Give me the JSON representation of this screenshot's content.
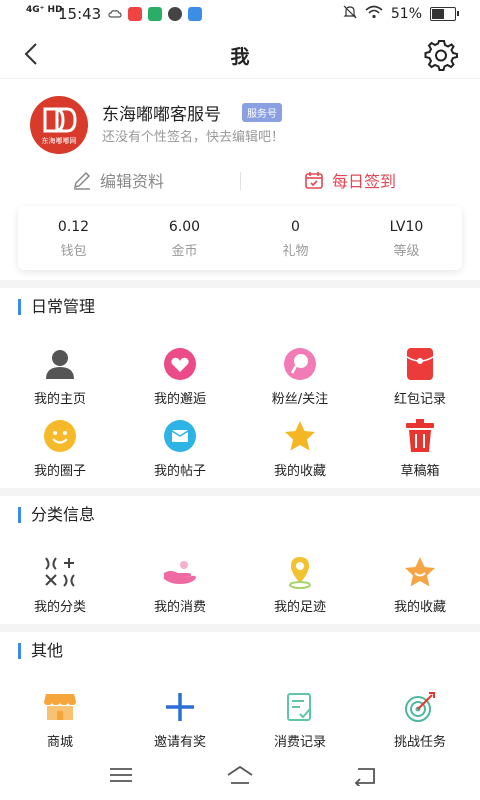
{
  "status": {
    "network": "4G⁺ HD",
    "time": "15:43",
    "battery": "51%",
    "battery_fraction": 0.51
  },
  "header": {
    "title": "我"
  },
  "profile": {
    "name": "东海嘟嘟客服号",
    "badge": "服务号",
    "signature": "还没有个性签名，快去编辑吧！",
    "avatar_caption": "东海嘟嘟网"
  },
  "actions": {
    "edit": "编辑资料",
    "checkin": "每日签到"
  },
  "stats": [
    {
      "value": "0.12",
      "label": "钱包"
    },
    {
      "value": "6.00",
      "label": "金币"
    },
    {
      "value": "0",
      "label": "礼物"
    },
    {
      "value": "LV10",
      "label": "等级"
    }
  ],
  "daily": {
    "title": "日常管理",
    "items": [
      {
        "label": "我的主页",
        "icon": "user-icon"
      },
      {
        "label": "我的邂逅",
        "icon": "heart-icon"
      },
      {
        "label": "粉丝/关注",
        "icon": "lollipop-icon"
      },
      {
        "label": "红包记录",
        "icon": "red-envelope-icon"
      },
      {
        "label": "我的圈子",
        "icon": "smile-icon"
      },
      {
        "label": "我的帖子",
        "icon": "post-icon"
      },
      {
        "label": "我的收藏",
        "icon": "star-icon"
      },
      {
        "label": "草稿箱",
        "icon": "trash-icon"
      }
    ]
  },
  "category": {
    "title": "分类信息",
    "items": [
      {
        "label": "我的分类",
        "icon": "category-icon"
      },
      {
        "label": "我的消费",
        "icon": "hand-icon"
      },
      {
        "label": "我的足迹",
        "icon": "location-icon"
      },
      {
        "label": "我的收藏",
        "icon": "star-smile-icon"
      }
    ]
  },
  "other": {
    "title": "其他",
    "items": [
      {
        "label": "商城",
        "icon": "shop-icon"
      },
      {
        "label": "邀请有奖",
        "icon": "plus-icon"
      },
      {
        "label": "消费记录",
        "icon": "record-icon"
      },
      {
        "label": "挑战任务",
        "icon": "target-icon"
      }
    ]
  },
  "colors": {
    "accent": "#3b8beb",
    "checkin": "#e04855",
    "badge": "#8aa0e0",
    "avatar": "#d83a2b"
  }
}
